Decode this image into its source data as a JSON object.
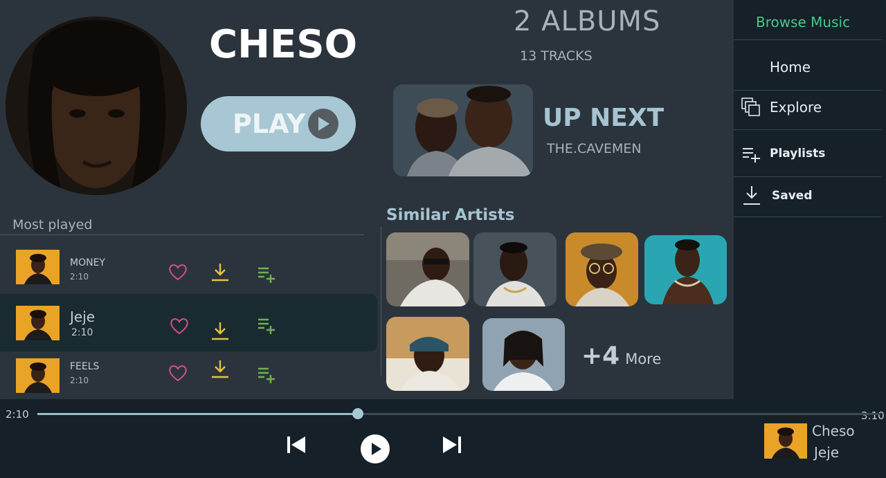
{
  "artist": {
    "name": "CHESO",
    "play_label": "PLAY"
  },
  "stats": {
    "albums": "2 ALBUMS",
    "tracks": "13 TRACKS"
  },
  "up_next": {
    "title": "UP NEXT",
    "artist": "THE.CAVEMEN"
  },
  "most_played": {
    "title": "Most played",
    "tracks": [
      {
        "title": "MONEY",
        "duration": "2:10",
        "active": false
      },
      {
        "title": "Jeje",
        "duration": "2:10",
        "active": true
      },
      {
        "title": "FEELS",
        "duration": "2:10",
        "active": false
      }
    ]
  },
  "similar_artists": {
    "title": "Similar Artists",
    "more_count": "+4",
    "more_label": "More"
  },
  "sidebar": {
    "title": "Browse Music",
    "items": [
      {
        "label": "Home",
        "icon": "home"
      },
      {
        "label": "Explore",
        "icon": "stacked-squares-icon"
      },
      {
        "label": "Playlists",
        "icon": "playlist-add-icon"
      },
      {
        "label": "Saved",
        "icon": "download-icon"
      }
    ]
  },
  "player": {
    "current_time": "2:10",
    "total_time": "3:10",
    "progress": 0.38,
    "now_playing_artist": "Cheso",
    "now_playing_track": "Jeje"
  },
  "colors": {
    "accent_green": "#49c98b",
    "accent_blue": "#a6c4d1",
    "heart_pink": "#d84f83",
    "download_yellow": "#e7c33a",
    "playlist_green": "#6cb34c"
  }
}
